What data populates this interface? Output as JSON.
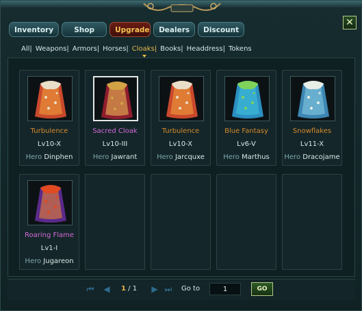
{
  "tabs": [
    {
      "label": "Inventory",
      "active": false
    },
    {
      "label": "Shop",
      "active": false
    },
    {
      "label": "Upgrade",
      "active": true
    },
    {
      "label": "Dealers",
      "active": false
    },
    {
      "label": "Discount",
      "active": false
    }
  ],
  "close_label": "✕",
  "filters": [
    "All|",
    "Weapons|",
    "Armors|",
    "Horses|",
    "Cloaks|",
    "Books|",
    "Headdress|",
    "Tokens"
  ],
  "active_filter": "Cloaks|",
  "hero_label": "Hero",
  "items": [
    {
      "name": "Turbulence",
      "name_color": "#d58a2d",
      "level": "Lv10-X",
      "hero": "Dinphen",
      "icon": "red-cloak-icon",
      "colors": [
        "#e9dfc9",
        "#c9492d",
        "#f0a43b"
      ],
      "selected": false
    },
    {
      "name": "Sacred Cloak",
      "name_color": "#d06ad8",
      "level": "Lv10-III",
      "hero": "Jawrant",
      "icon": "sacred-cloak-icon",
      "colors": [
        "#d2a245",
        "#8e1d2e",
        "#f2c45a"
      ],
      "selected": true
    },
    {
      "name": "Turbulence",
      "name_color": "#d58a2d",
      "level": "Lv10-X",
      "hero": "Jarcquxe",
      "icon": "red-cloak-icon",
      "colors": [
        "#e9dfc9",
        "#c9492d",
        "#f0a43b"
      ],
      "selected": false
    },
    {
      "name": "Blue Fantasy",
      "name_color": "#d58a2d",
      "level": "Lv6-V",
      "hero": "Marthus",
      "icon": "blue-cloak-icon",
      "colors": [
        "#7fd35b",
        "#2b8fc2",
        "#44c6e0"
      ],
      "selected": false
    },
    {
      "name": "Snowflakes",
      "name_color": "#d58a2d",
      "level": "Lv11-X",
      "hero": "Dracojame",
      "icon": "snow-cloak-icon",
      "colors": [
        "#e7efe6",
        "#3d86b3",
        "#8ad0e6"
      ],
      "selected": false
    },
    {
      "name": "Roaring Flame",
      "name_color": "#d06ad8",
      "level": "Lv1-I",
      "hero": "Jugareon",
      "icon": "flame-cloak-icon",
      "colors": [
        "#e24a22",
        "#5a2a8a",
        "#f58a2a"
      ],
      "selected": false
    }
  ],
  "pagination": {
    "current": "1",
    "total": "/ 1"
  },
  "goto_label": "Go to",
  "goto_value": "1",
  "go_label": "GO"
}
